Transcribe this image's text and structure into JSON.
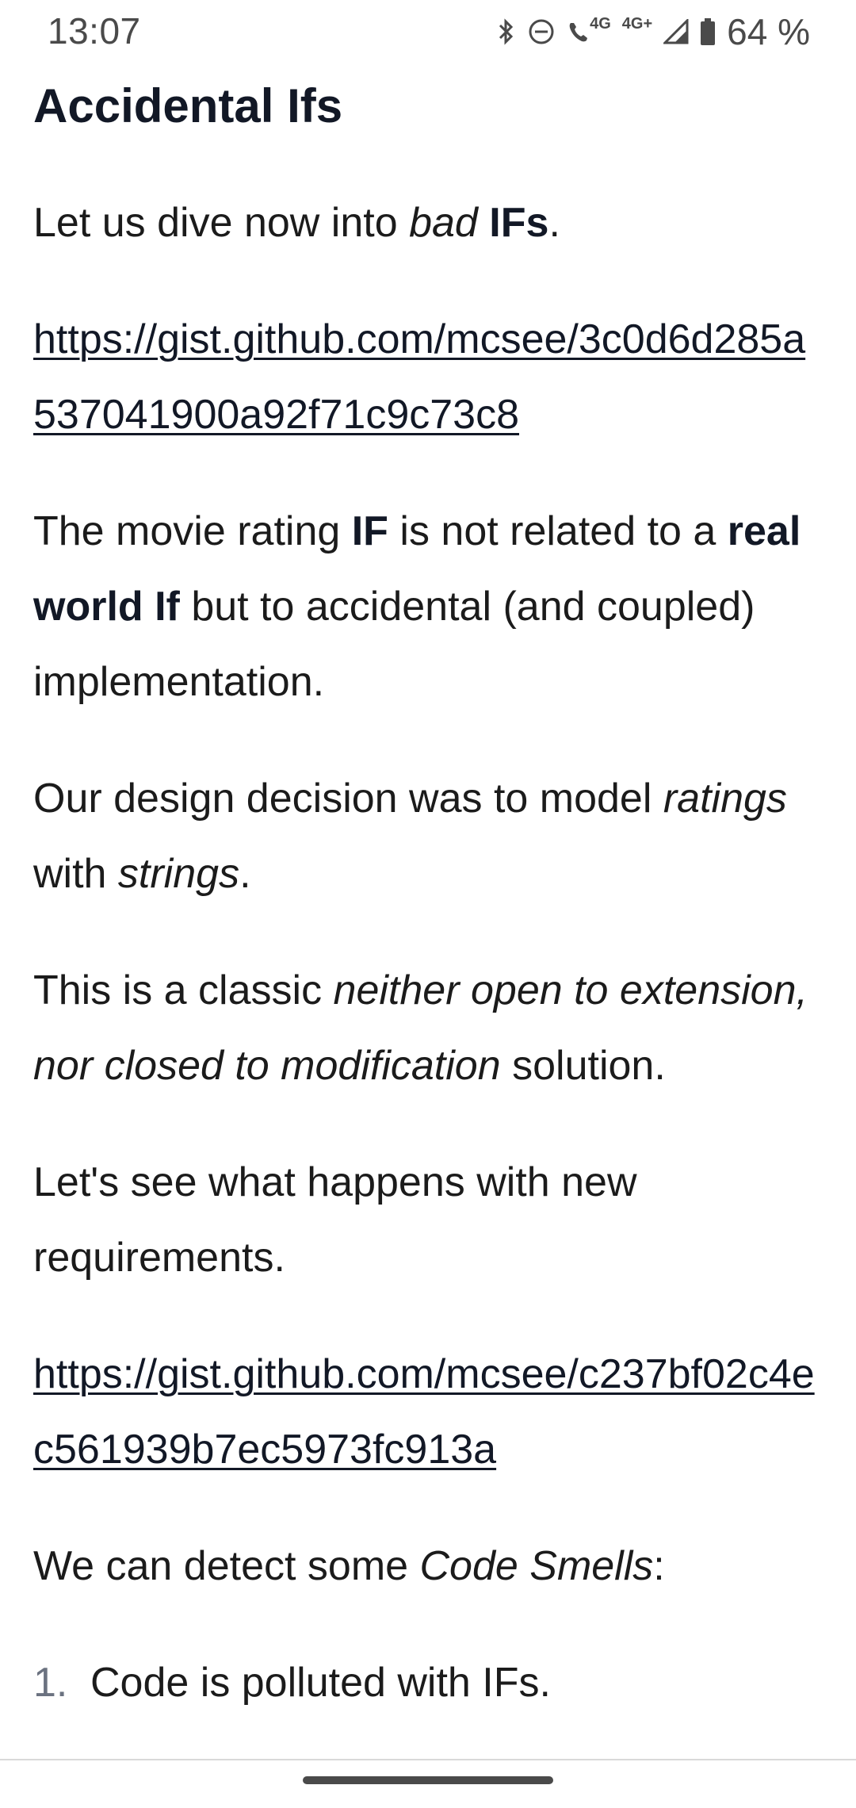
{
  "status_bar": {
    "time": "13:07",
    "battery": "64 %",
    "network_labels": [
      "4G",
      "4G+"
    ],
    "icons": [
      "bluetooth-icon",
      "do-not-disturb-icon",
      "volte-call-icon",
      "signal-icon",
      "battery-icon"
    ]
  },
  "article": {
    "heading": "Accidental Ifs",
    "p1": {
      "t1": "Let us dive now into ",
      "em1": "bad",
      "t2": " ",
      "b1": "IFs",
      "t3": "."
    },
    "link1": "https://gist.github.com/mcsee/3c0d6d285a537041900a92f71c9c73c8",
    "p2": {
      "t1": "The movie rating ",
      "b1": "IF",
      "t2": " is not related to a ",
      "b2": "real world If",
      "t3": " but to accidental (and coupled) implementation."
    },
    "p3": {
      "t1": "Our design decision was to model ",
      "em1": "ratings",
      "t2": " with ",
      "em2": "strings",
      "t3": "."
    },
    "p4": {
      "t1": "This is a classic ",
      "em1": "neither open to extension, nor closed to modification",
      "t2": " solution."
    },
    "p5": "Let's see what happens with new requirements.",
    "link2": "https://gist.github.com/mcsee/c237bf02c4ec561939b7ec5973fc913a",
    "p6": {
      "t1": "We can detect some ",
      "em1": "Code Smells",
      "t2": ":"
    },
    "list": [
      {
        "num": "1.",
        "text": "Code is polluted with IFs."
      }
    ]
  },
  "colors": {
    "text": "#1b1b1b",
    "heading": "#121826",
    "status": "#4a4a4a",
    "background": "#ffffff"
  }
}
